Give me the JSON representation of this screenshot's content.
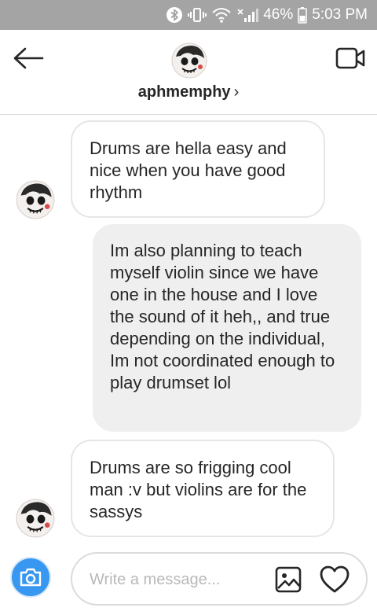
{
  "status_bar": {
    "battery_percent": "46%",
    "time": "5:03 PM",
    "icons": [
      "bluetooth-icon",
      "vibrate-icon",
      "wifi-icon",
      "signal-icon",
      "battery-icon"
    ]
  },
  "header": {
    "username": "aphmemphy",
    "chevron": "›",
    "icons": [
      "back-arrow-icon",
      "profile-avatar",
      "video-call-icon"
    ]
  },
  "messages": [
    {
      "side": "incoming",
      "text": "Drums are hella easy and nice when you have good rhythm"
    },
    {
      "side": "outgoing",
      "text": "Im also planning to teach myself violin since we have one in the house and I love the sound of it heh,, and true depending on the individual, Im not coordinated enough to play drumset lol"
    },
    {
      "side": "incoming",
      "text": "Drums are so frigging cool man :v but violins are for the sassys"
    }
  ],
  "composer": {
    "placeholder": "Write a message...",
    "icons": [
      "camera-icon",
      "gallery-icon",
      "heart-icon"
    ]
  },
  "colors": {
    "status_bar": "#a4a4a4",
    "accent_blue": "#3897f0",
    "outgoing_bubble": "#efefef",
    "incoming_border": "#e6e6e6"
  }
}
